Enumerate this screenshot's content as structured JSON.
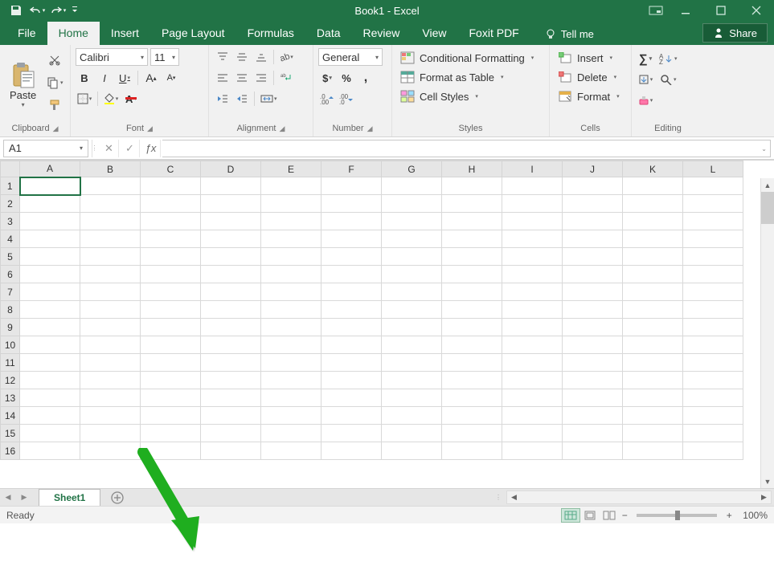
{
  "title": "Book1 - Excel",
  "tabs": [
    "File",
    "Home",
    "Insert",
    "Page Layout",
    "Formulas",
    "Data",
    "Review",
    "View",
    "Foxit PDF"
  ],
  "tellme": "Tell me",
  "share": "Share",
  "groups": {
    "clipboard": "Clipboard",
    "paste": "Paste",
    "font": "Font",
    "alignment": "Alignment",
    "number": "Number",
    "styles": "Styles",
    "cells": "Cells",
    "editing": "Editing"
  },
  "font": {
    "name": "Calibri",
    "size": "11",
    "bold": "B",
    "italic": "I",
    "underline": "U"
  },
  "numfmt": "General",
  "styles": {
    "cond": "Conditional Formatting",
    "table": "Format as Table",
    "cell": "Cell Styles"
  },
  "cells": {
    "insert": "Insert",
    "delete": "Delete",
    "format": "Format"
  },
  "namebox": "A1",
  "columns": [
    "A",
    "B",
    "C",
    "D",
    "E",
    "F",
    "G",
    "H",
    "I",
    "J",
    "K",
    "L"
  ],
  "rows": [
    "1",
    "2",
    "3",
    "4",
    "5",
    "6",
    "7",
    "8",
    "9",
    "10",
    "11",
    "12",
    "13",
    "14",
    "15",
    "16"
  ],
  "sheet_tab": "Sheet1",
  "status": "Ready",
  "zoom": "100%"
}
